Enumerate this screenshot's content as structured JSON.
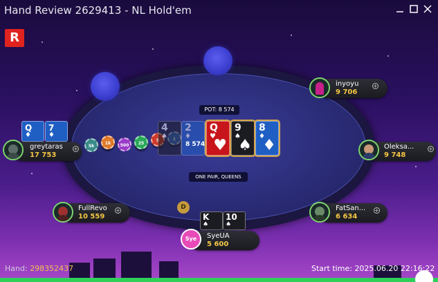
{
  "window": {
    "title": "Hand Review 2629413 - NL Hold'em",
    "controls": [
      "minimize-icon",
      "maximize-icon",
      "close-icon"
    ]
  },
  "logo": {
    "letter": "R",
    "color": "#e0231e"
  },
  "table": {
    "pot_label": "POT: 8 574",
    "hand_rank": "ONE PAIR, QUEENS",
    "dealer_label": "D",
    "board": [
      {
        "rank": "4",
        "suit": "♠",
        "color": "black",
        "dim": true
      },
      {
        "rank": "2",
        "suit": "♦",
        "color": "blue",
        "dim": true
      },
      {
        "rank": "Q",
        "suit": "♥",
        "color": "red",
        "highlight": true
      },
      {
        "rank": "9",
        "suit": "♠",
        "color": "black",
        "highlight": true
      },
      {
        "rank": "8",
        "suit": "♦",
        "color": "blue",
        "highlight": true
      }
    ],
    "pot_chips": [
      {
        "label": "5k",
        "color": "#3a8a8a"
      },
      {
        "label": "1k",
        "color": "#e07a2a"
      },
      {
        "label": "500",
        "color": "#9a3ac8"
      },
      {
        "label": "25",
        "color": "#2aa85a"
      },
      {
        "label": "5",
        "color": "#d03a2a"
      },
      {
        "label": "1",
        "color": "#3a6ad0"
      }
    ],
    "side_amount": "8 574"
  },
  "players": [
    {
      "name": "inyoyu",
      "stack": "9 706"
    },
    {
      "name": "greytaras",
      "stack": "17 753",
      "cards": [
        {
          "rank": "Q",
          "suit": "♦"
        },
        {
          "rank": "7",
          "suit": "♦"
        }
      ]
    },
    {
      "name": "Oleksa...",
      "stack": "9 748"
    },
    {
      "name": "FullRevo",
      "stack": "10 559"
    },
    {
      "name": "FatSan...",
      "stack": "6 634"
    },
    {
      "name": "SyeUA",
      "stack": "5 600",
      "avatar_text": "Sye",
      "cards": [
        {
          "rank": "K",
          "suit": "♠"
        },
        {
          "rank": "10",
          "suit": "♠"
        }
      ]
    }
  ],
  "footer": {
    "hand_label": "Hand:",
    "hand_id": "298352437",
    "start_label": "Start time:",
    "start_time": "2025.06.20 22:16:22"
  },
  "colors": {
    "stack_text": "#f5c842",
    "avatar_ring": "#7cd46c",
    "card_blue": "#1f5fc4",
    "card_red": "#c8151c",
    "card_black": "#1b1b22"
  }
}
